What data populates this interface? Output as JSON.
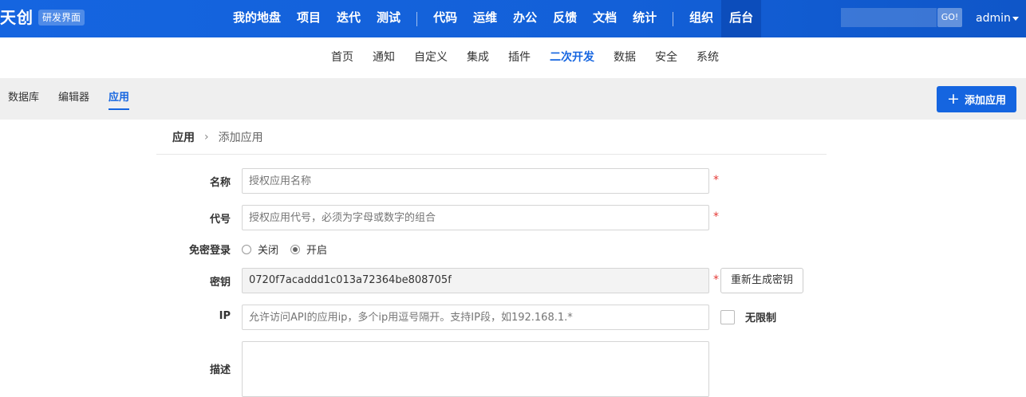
{
  "topbar": {
    "brand": "天创",
    "mode_badge": "研发界面",
    "nav_group1": [
      "我的地盘",
      "项目",
      "迭代",
      "测试"
    ],
    "nav_group2": [
      "代码",
      "运维",
      "办公",
      "反馈",
      "文档",
      "统计"
    ],
    "nav_group3": [
      "组织",
      "后台"
    ],
    "active_nav": "后台",
    "search_button": "GO!",
    "user": "admin"
  },
  "subnav": {
    "items": [
      "首页",
      "通知",
      "自定义",
      "集成",
      "插件",
      "二次开发",
      "数据",
      "安全",
      "系统"
    ],
    "active": "二次开发"
  },
  "toolbar": {
    "tabs": [
      "数据库",
      "编辑器",
      "应用"
    ],
    "active_tab": "应用",
    "add_button": "添加应用",
    "add_icon": "plus-icon"
  },
  "breadcrumb": {
    "root": "应用",
    "separator": "›",
    "current": "添加应用"
  },
  "form": {
    "name_label": "名称",
    "name_placeholder": "授权应用名称",
    "code_label": "代号",
    "code_placeholder": "授权应用代号，必须为字母或数字的组合",
    "free_login_label": "免密登录",
    "free_login_options": [
      "关闭",
      "开启"
    ],
    "free_login_selected": "开启",
    "secret_label": "密钥",
    "secret_value": "0720f7acaddd1c013a72364be808705f",
    "regen_button": "重新生成密钥",
    "ip_label": "IP",
    "ip_placeholder": "允许访问API的应用ip，多个ip用逗号隔开。支持IP段，如192.168.1.*",
    "ip_unlimited_label": "无限制",
    "desc_label": "描述",
    "required_mark": "*"
  },
  "colors": {
    "primary": "#1565e0",
    "required": "#e53935",
    "toolbar_bg": "#efefef"
  }
}
